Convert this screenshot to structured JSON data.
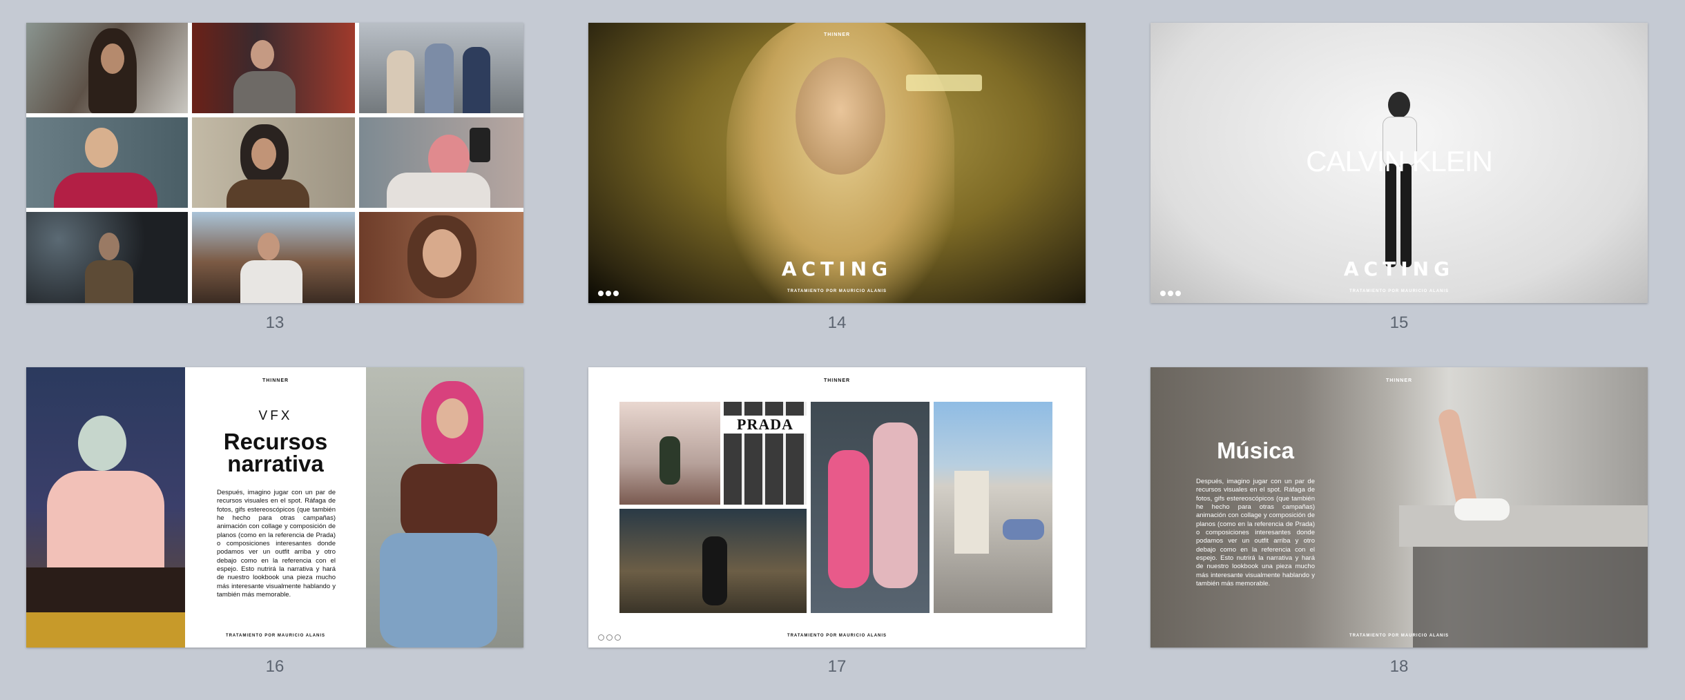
{
  "slides": [
    {
      "number": "13"
    },
    {
      "number": "14",
      "brand": "THINNER",
      "title": "ACTING",
      "footer": "TRATAMIENTO POR MAURICIO ALANIS"
    },
    {
      "number": "15",
      "brand": "THINNER",
      "logo_text": "CALVIN KLEIN",
      "title": "ACTING",
      "footer": "TRATAMIENTO POR MAURICIO ALANIS"
    },
    {
      "number": "16",
      "brand": "THINNER",
      "kicker": "VFX",
      "heading_line1": "Recursos",
      "heading_line2": "narrativa",
      "body": "Después, imagino jugar con un par de recursos visuales en el spot. Ráfaga de fotos, gifs estereoscópicos (que también he hecho para otras campañas) animación con collage y composición de planos (como en la referencia de Prada) o composiciones interesantes donde podamos ver un outfit arriba y otro debajo como en la referencia con el espejo. Esto nutrirá la narrativa y hará de nuestro lookbook una pieza mucho más interesante visualmente hablando y también más memorable.",
      "footer": "TRATAMIENTO POR MAURICIO ALANIS"
    },
    {
      "number": "17",
      "brand": "THINNER",
      "prada_text": "PRADA",
      "footer": "TRATAMIENTO POR MAURICIO ALANIS"
    },
    {
      "number": "18",
      "brand": "THINNER",
      "heading": "Música",
      "body": "Después, imagino jugar con un par de recursos visuales en el spot. Ráfaga de fotos, gifs estereoscópicos (que también he hecho para otras campañas) animación con collage y composición de planos (como en la referencia de Prada) o composiciones interesantes donde podamos ver un outfit arriba y otro debajo como en la referencia con el espejo. Esto nutrirá la narrativa y hará de nuestro lookbook una pieza mucho más interesante visualmente hablando y también más memorable.",
      "footer": "TRATAMIENTO POR MAURICIO ALANIS"
    }
  ],
  "colors": {
    "background": "#c5cad3",
    "slide_number": "#5c6470"
  }
}
